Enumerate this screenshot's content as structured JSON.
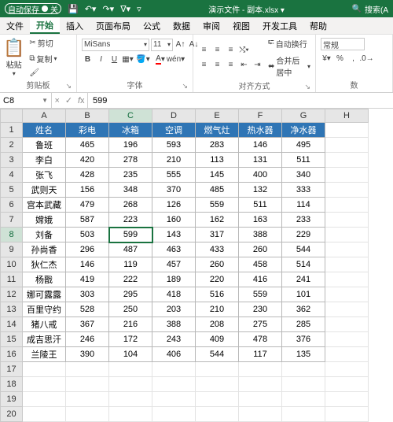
{
  "titlebar": {
    "autosave_label": "自动保存",
    "autosave_state": "关",
    "filename": "演示文件 - 副本.xlsx ▾",
    "search_placeholder": "搜索(A"
  },
  "tabs": {
    "items": [
      "文件",
      "开始",
      "插入",
      "页面布局",
      "公式",
      "数据",
      "审阅",
      "视图",
      "开发工具",
      "帮助"
    ],
    "active_index": 1
  },
  "ribbon": {
    "clipboard": {
      "paste": "粘贴",
      "cut": "剪切",
      "copy": "复制",
      "label": "剪贴板"
    },
    "font": {
      "name": "MiSans",
      "size": "11",
      "label": "字体"
    },
    "align": {
      "wrap": "自动换行",
      "merge": "合并后居中",
      "label": "对齐方式"
    },
    "number": {
      "format": "常规",
      "label": "数"
    }
  },
  "fxbar": {
    "cell_ref": "C8",
    "value": "599"
  },
  "columns": [
    "A",
    "B",
    "C",
    "D",
    "E",
    "F",
    "G",
    "H"
  ],
  "selected": {
    "col": "C",
    "row": 8
  },
  "chart_data": {
    "type": "table",
    "headers": [
      "姓名",
      "彩电",
      "冰箱",
      "空调",
      "燃气灶",
      "热水器",
      "净水器"
    ],
    "rows": [
      [
        "鲁班",
        465,
        196,
        593,
        283,
        146,
        495
      ],
      [
        "李白",
        420,
        278,
        210,
        113,
        131,
        511
      ],
      [
        "张飞",
        428,
        235,
        555,
        145,
        400,
        340
      ],
      [
        "武则天",
        156,
        348,
        370,
        485,
        132,
        333
      ],
      [
        "宫本武藏",
        479,
        268,
        126,
        559,
        511,
        114
      ],
      [
        "嫦娥",
        587,
        223,
        160,
        162,
        163,
        233
      ],
      [
        "刘备",
        503,
        599,
        143,
        317,
        388,
        229
      ],
      [
        "孙尚香",
        296,
        487,
        463,
        433,
        260,
        544
      ],
      [
        "狄仁杰",
        146,
        119,
        457,
        260,
        458,
        514
      ],
      [
        "杨戬",
        419,
        222,
        189,
        220,
        416,
        241
      ],
      [
        "娜可露露",
        303,
        295,
        418,
        516,
        559,
        101
      ],
      [
        "百里守约",
        528,
        250,
        203,
        210,
        230,
        362
      ],
      [
        "猪八戒",
        367,
        216,
        388,
        208,
        275,
        285
      ],
      [
        "成吉思汗",
        246,
        172,
        243,
        409,
        478,
        376
      ],
      [
        "兰陵王",
        390,
        104,
        406,
        544,
        117,
        135
      ]
    ]
  },
  "extra_rows": [
    17,
    18,
    19,
    20
  ]
}
